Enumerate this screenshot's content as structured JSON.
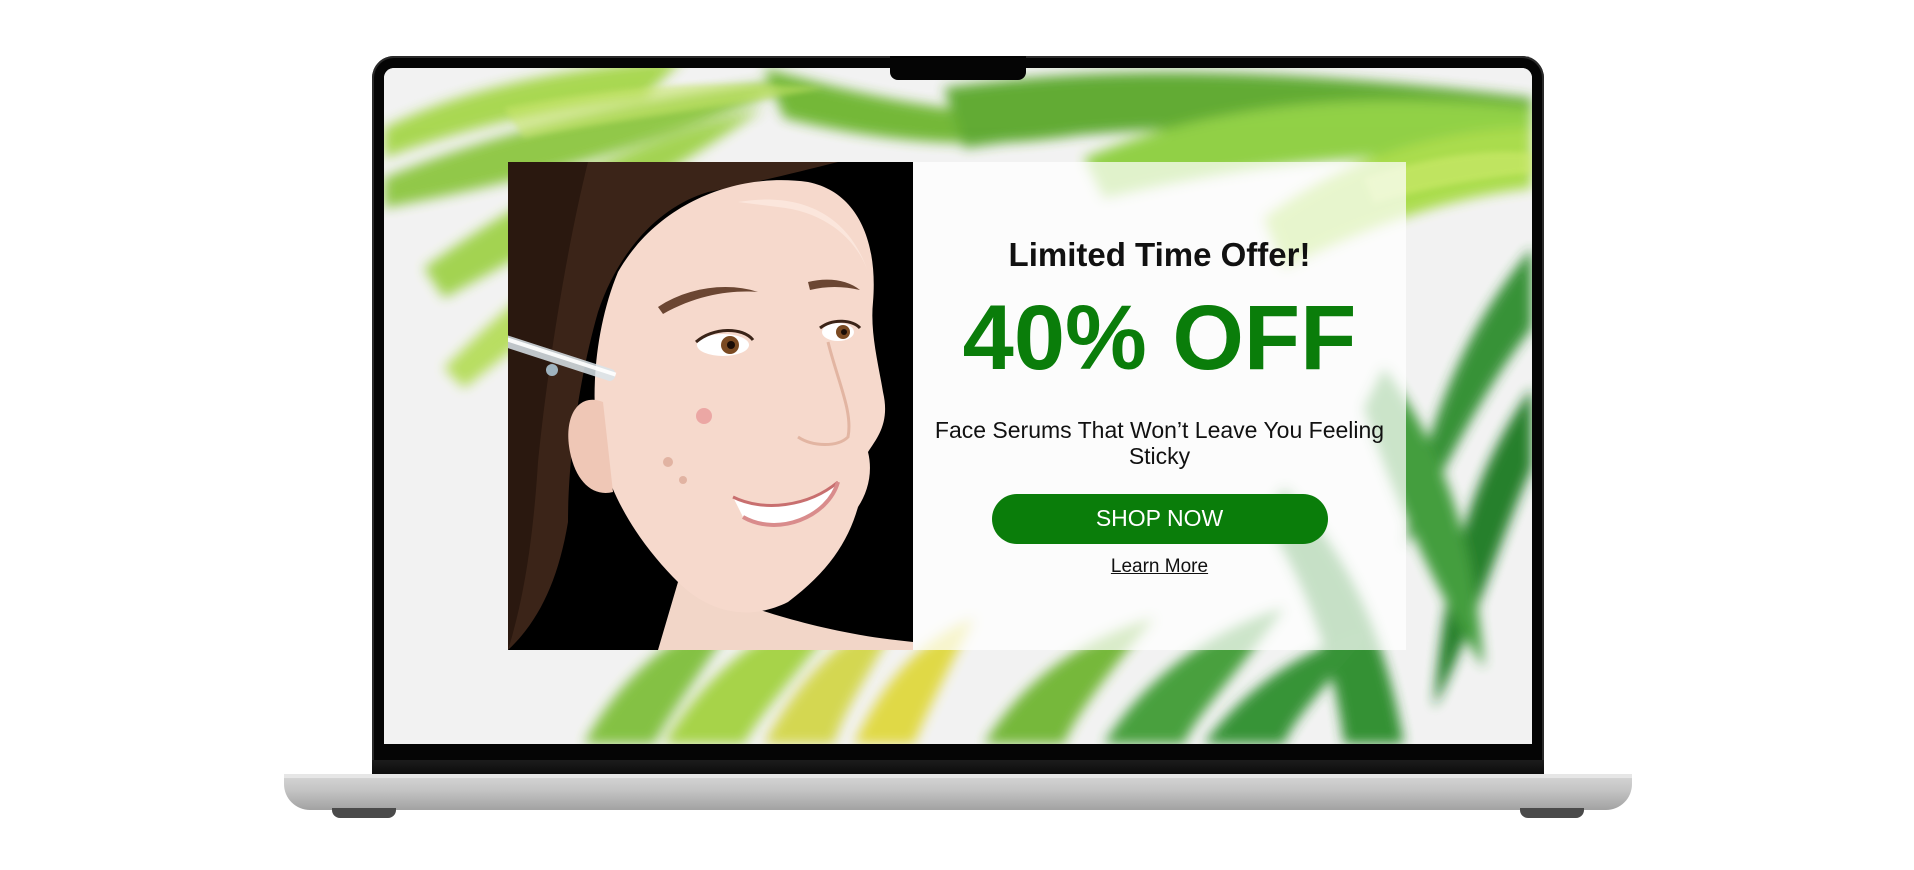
{
  "ad": {
    "headline": "Limited Time Offer!",
    "discount": "40% OFF",
    "tagline": "Face Serums That Won’t Leave You Feeling Sticky",
    "cta_label": "SHOP NOW",
    "secondary_link": "Learn More"
  },
  "colors": {
    "accent_green": "#0a7d0a",
    "text_dark": "#111111",
    "laptop_bezel": "#050505",
    "laptop_base": "#c4c4c4"
  },
  "icons": {
    "background": "palm-leaves-illustration",
    "photo": "woman-applying-serum-photo"
  }
}
